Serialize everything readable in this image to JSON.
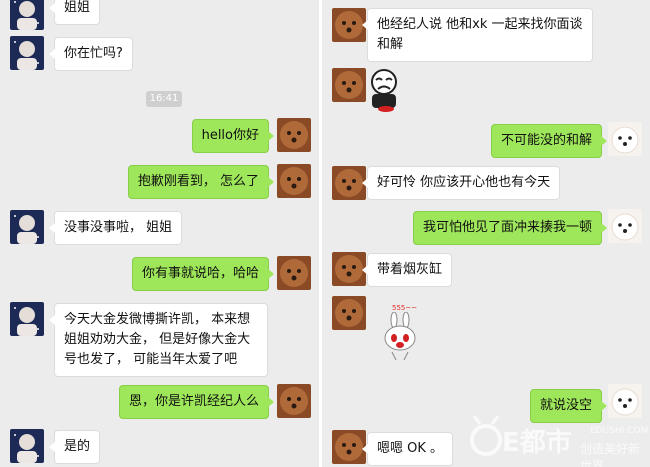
{
  "left_chat": {
    "timestamp": "16:41",
    "messages": [
      {
        "side": "left",
        "text": "姐姐"
      },
      {
        "side": "left",
        "text": "你在忙吗?"
      },
      {
        "side": "right",
        "text": "hello你好"
      },
      {
        "side": "right",
        "text": "抱歉刚看到， 怎么了"
      },
      {
        "side": "left",
        "text": "没事没事啦， 姐姐"
      },
      {
        "side": "right",
        "text": "你有事就说哈，哈哈"
      },
      {
        "side": "left",
        "text": "今天大金发微博撕许凯， 本来想姐姐劝劝大金， 但是好像大金大号也发了， 可能当年太爱了吧"
      },
      {
        "side": "right",
        "text": "恩，你是许凯经纪人么"
      },
      {
        "side": "left",
        "text": "是的"
      }
    ]
  },
  "right_chat": {
    "messages": [
      {
        "side": "left",
        "text": "他经纪人说 他和xk 一起来找你面谈和解"
      },
      {
        "side": "left",
        "type": "sticker",
        "icon": "crying-cartoon-sticker"
      },
      {
        "side": "right",
        "text": "不可能没的和解"
      },
      {
        "side": "left",
        "text": "好可怜 你应该开心他也有今天"
      },
      {
        "side": "right",
        "text": "我可怕他见了面冲来揍我一顿"
      },
      {
        "side": "left",
        "text": "带着烟灰缸"
      },
      {
        "side": "left",
        "type": "sticker",
        "icon": "rabbit-sticker",
        "caption": "555~~"
      },
      {
        "side": "right",
        "text": "就说没空"
      },
      {
        "side": "left",
        "text": "嗯嗯 OK 。"
      }
    ]
  },
  "watermark": {
    "brand": "E都市",
    "url": "EDUSHI.COM",
    "slogan": "创造美好新世界"
  },
  "colors": {
    "panel_bg": "#ececec",
    "bubble_green": "#9ee65a",
    "bubble_white": "#ffffff",
    "avatar_navy": "#1d2a56",
    "avatar_brown": "#8a4a26"
  }
}
